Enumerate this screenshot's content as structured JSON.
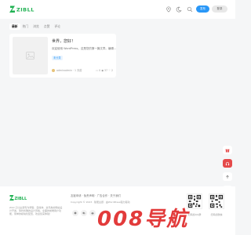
{
  "header": {
    "logo_text": "ZIBLL",
    "publish_label": "发布",
    "login_label": "登录",
    "icons": [
      "location-icon",
      "moon-icon",
      "search-icon"
    ]
  },
  "tabs": [
    {
      "label": "最新",
      "active": true
    },
    {
      "label": "热门",
      "active": false
    },
    {
      "label": "浏览",
      "active": false
    },
    {
      "label": "点赞",
      "active": false
    },
    {
      "label": "评论",
      "active": false
    }
  ],
  "post": {
    "title": "世界，您好！",
    "excerpt": "欢迎使用 WordPress。这是您的第一篇文章。编辑...",
    "tag": "未分类",
    "author": "adminadmin",
    "time": "1 天前",
    "comments": "0",
    "views": "37",
    "likes": "2"
  },
  "float_bar": [
    "gift-icon",
    "headset-icon",
    "up-arrow-icon",
    "collapse-icon"
  ],
  "footer": {
    "logo_text": "ZIBLL",
    "links": "友链申请 · 免责声明 · 广告合作 · 关于我们",
    "desc_1": "Zibll 子比主题专为博客、自媒体、资讯类的网站设计开发，简约优雅的设计风格，全面的前端用户功能，简单的模块化配置，欢迎您来体验！",
    "copyright": "Copyright © 2023 · 随便主题 · 由WordPress强力驱动",
    "qr_labels": [
      "扫码加QQ群",
      "扫码加微信"
    ],
    "watermark": "008导航"
  },
  "colors": {
    "accent": "#2997f7",
    "logo_green": "#1fb152",
    "float_red": "#e54a4a",
    "watermark": "#e23b3b"
  }
}
